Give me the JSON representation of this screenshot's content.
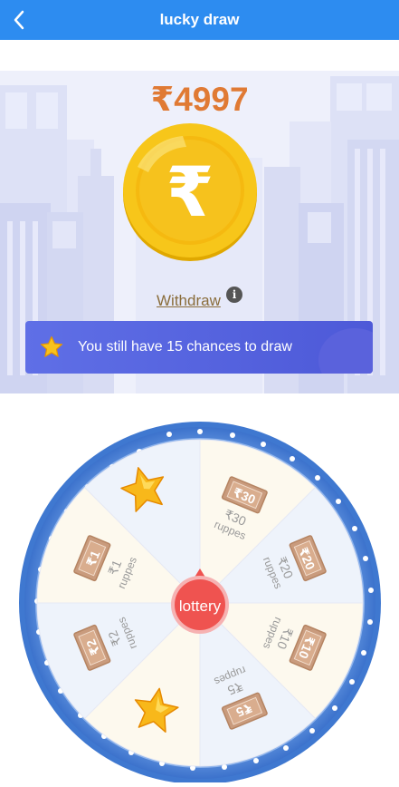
{
  "header": {
    "title": "lucky draw",
    "back_icon": "chevron-left-icon"
  },
  "balance": {
    "amount": "₹4997",
    "coin_symbol": "₹",
    "withdraw_label": "Withdraw",
    "info_icon": "info-icon"
  },
  "chances": {
    "text": "You still have 15 chances to draw",
    "icon": "star-icon"
  },
  "wheel": {
    "center_label": "lottery",
    "segments": [
      {
        "badge": "₹30",
        "amount": "₹30",
        "unit": "ruppes"
      },
      {
        "badge": "₹20",
        "amount": "₹20",
        "unit": "ruppes"
      },
      {
        "badge": "₹10",
        "amount": "₹10",
        "unit": "ruppes"
      },
      {
        "badge": "₹5",
        "amount": "₹5",
        "unit": "ruppes"
      },
      {
        "prize": "star-icon"
      },
      {
        "badge": "₹2",
        "amount": "₹2",
        "unit": "ruppes"
      },
      {
        "badge": "₹1",
        "amount": "₹1",
        "unit": "ruppes"
      },
      {
        "prize": "star-icon"
      }
    ]
  },
  "colors": {
    "topbar": "#2d8cf0",
    "amount": "#e07a34",
    "coin": "#f5c518",
    "banner": "#5563df",
    "wheel_rim": "#4a84d6",
    "center_button": "#ef5350"
  }
}
